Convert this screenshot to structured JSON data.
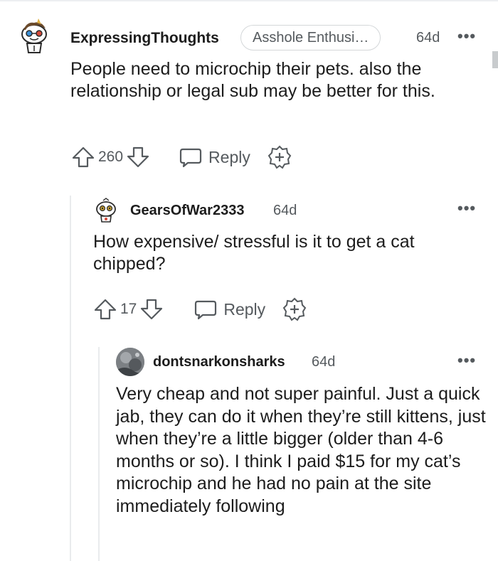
{
  "comments": [
    {
      "username": "ExpressingThoughts",
      "flair": "Asshole Enthusi…",
      "age": "64d",
      "more": "•••",
      "body": "People need to microchip their pets. also the relationship or legal sub may be better for this.",
      "votes": "260",
      "reply_label": "Reply"
    },
    {
      "username": "GearsOfWar2333",
      "age": "64d",
      "more": "•••",
      "body": "How expensive/ stressful is it to get a cat chipped?",
      "votes": "17",
      "reply_label": "Reply"
    },
    {
      "username": "dontsnarkonsharks",
      "age": "64d",
      "more": "•••",
      "body": "Very cheap and not super painful. Just a quick jab, they can do it when they’re still kittens, just when they’re a little bigger (older than 4-6 months or so). I think I paid $15 for my cat’s microchip and he had no pain at the site immediately following"
    }
  ],
  "colors": {
    "text": "#1c1c1c",
    "meta": "#555a5e",
    "border": "#d4d7d9",
    "thread_line": "#e9ebed"
  },
  "icons": [
    "upvote-icon",
    "downvote-icon",
    "comment-bubble-icon",
    "award-icon",
    "more-options-icon"
  ]
}
